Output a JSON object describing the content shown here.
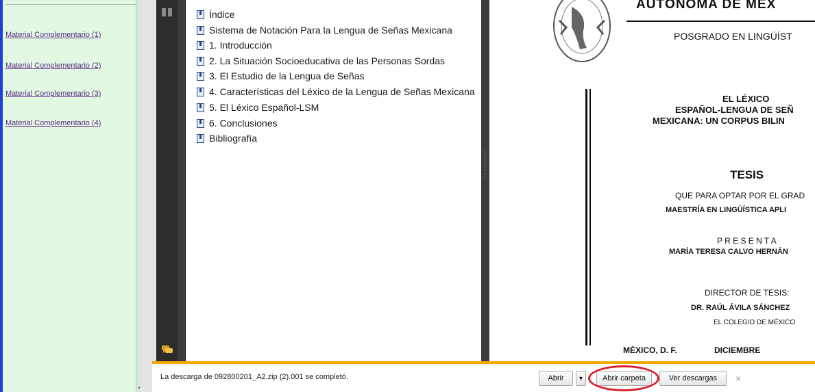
{
  "left_panel": {
    "links": [
      "Material Complementario (1)",
      "Material Complementario (2)",
      "Material Complementario (3)",
      "Material Complementario (4)"
    ]
  },
  "bookmarks": [
    "Índice",
    "Sistema de Notación Para la Lengua de Señas Mexicana",
    "1. Introducción",
    "2. La Situación Socioeducativa de las Personas Sordas",
    "3. El Estudio de la Lengua de Señas",
    "4. Características del Léxico de la Lengua de Señas Mexicana",
    "5. El Léxico Español-LSM",
    "6. Conclusiones",
    "Bibliografía"
  ],
  "page": {
    "header_title": "AUTÓNOMA DE MÉX",
    "posgrado": "POSGRADO EN LINGÜÍST",
    "title_line1": "EL LÉXICO",
    "title_line2": "ESPAÑOL-LENGUA DE SEÑ",
    "title_line3": "MEXICANA: UN CORPUS BILIN",
    "tesis": "TESIS",
    "optar": "QUE PARA OPTAR POR EL GRAD",
    "maestria": "MAESTRÍA EN LINGÜÍSTICA APLI",
    "presenta": "P R E S E N T A",
    "autora": "MARÍA TERESA CALVO HERNÁN",
    "director_label": "DIRECTOR DE TESIS:",
    "director_name": "DR. RAÚL ÁVILA SÁNCHEZ",
    "colegio": "EL COLEGIO DE MÉXICO",
    "lugar": "MÉXICO, D. F.",
    "mes": "DICIEMBRE"
  },
  "download_bar": {
    "message": "La descarga de 092800201_A2.zip (2).001 se completó.",
    "open_label": "Abrir",
    "dropdown_glyph": "▾",
    "open_folder_label": "Abrir carpeta",
    "view_downloads_label": "Ver descargas",
    "close_glyph": "×"
  },
  "colors": {
    "left_bg": "#e2f8e2",
    "link": "#5a2d82",
    "accent_bar": "#f5a800",
    "highlight": "#d8202a"
  },
  "icons": [
    "bookmark-icon",
    "document-icon",
    "comment-icon",
    "seal-logo",
    "dropdown-arrow-icon",
    "close-icon"
  ]
}
